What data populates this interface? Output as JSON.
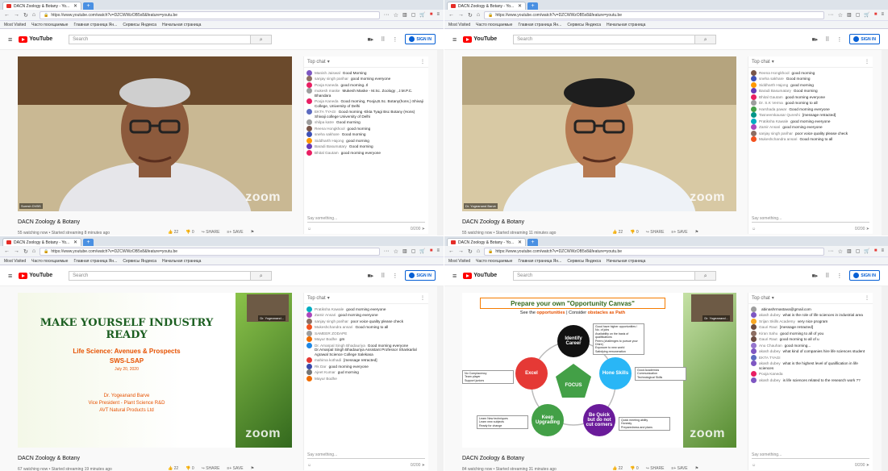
{
  "browser": {
    "tab_title": "DACN Zoology & Botany - Yo...",
    "tab_close": "✕",
    "new_tab": "+",
    "url": "https://www.youtube.com/watch?v=DZCWWzOB5x8&feature=youtu.be",
    "url_dots": "···",
    "bookmarks": [
      "Most Visited",
      "Часто посещаемые",
      "Главная страница Ян...",
      "Сервисы Яндекса",
      "Начальная страница"
    ]
  },
  "youtube": {
    "logo_text": "YouTube",
    "search_placeholder": "Search",
    "sign_in": "SIGN IN"
  },
  "video": {
    "title": "DACN Zoology & Botany",
    "zoom_watermark": "zoom",
    "actions": [
      "22",
      "0",
      "SHARE",
      "SAVE"
    ]
  },
  "chat": {
    "header": "Top chat",
    "input_placeholder": "Say something...",
    "counter": "0/200"
  },
  "panels": [
    {
      "meta": "55 watching now • Started streaming 8 minutes ago",
      "speaker": "Suresh DVBS",
      "messages": [
        {
          "author": "Manish Jaiswal",
          "text": "Good Morning",
          "color": "#7e57c2"
        },
        {
          "author": "sanjay singh parihar",
          "text": "good morning everyone",
          "color": "#8d6e63"
        },
        {
          "author": "Pooja Kaneda",
          "text": "good morning..Il",
          "color": "#e91e63"
        },
        {
          "author": "mukesh maske",
          "text": "Mukesh Maske - M.Sc. Zoology , J.M.P.C. Bhandara",
          "color": "#9e9e9e"
        },
        {
          "author": "Pooja Kaneda",
          "text": "Good morning, Pooja,B.Sc. Botany(hons.) Shivaji College, University of Delhi",
          "color": "#e91e63"
        },
        {
          "author": "EKTA TYAGI",
          "text": "Good morning -Ekta Tyagi Bsc Botany (Hons) Shivaji college University of Delhi",
          "color": "#5c6bc0"
        },
        {
          "author": "shilpa katre",
          "text": "Good morning",
          "color": "#9e9e9e"
        },
        {
          "author": "Reena Hongkhool",
          "text": "good morning",
          "color": "#795548"
        },
        {
          "author": "sneha sakhare",
          "text": "Good morning",
          "color": "#3f51b5"
        },
        {
          "author": "Siddharth Hajong",
          "text": "good morning",
          "color": "#ff9800"
        },
        {
          "author": "Baradi Basumatary",
          "text": "Good morning",
          "color": "#673ab7"
        },
        {
          "author": "Bhital Gautam",
          "text": "good morning everyone",
          "color": "#e91e63"
        }
      ]
    },
    {
      "meta": "55 watching now • Started streaming 11 minutes ago",
      "speaker": "Dr. Yogeanand Barve",
      "messages": [
        {
          "author": "Reena Hongkhool",
          "text": "good morning",
          "color": "#795548"
        },
        {
          "author": "sneha sakhare",
          "text": "Good morning",
          "color": "#3f51b5"
        },
        {
          "author": "Siddharth Hajong",
          "text": "good morning",
          "color": "#ff9800"
        },
        {
          "author": "Baradi Basumatary",
          "text": "Good morning",
          "color": "#673ab7"
        },
        {
          "author": "Bhital Gautam",
          "text": "good morning everyone",
          "color": "#e91e63"
        },
        {
          "author": "Dr. S.K Verma",
          "text": "good morning to all",
          "color": "#9e9e9e"
        },
        {
          "author": "Harshada pawar",
          "text": "Good morning everyone",
          "color": "#43a047"
        },
        {
          "author": "Tasneemkausar Qureshi",
          "text": "[message retracted]",
          "color": "#009688"
        },
        {
          "author": "Pratiksha Kawale",
          "text": "good morning everyone",
          "color": "#00acc1"
        },
        {
          "author": "Zamir Ansari",
          "text": "good morning everyone",
          "color": "#ab47bc"
        },
        {
          "author": "sanjay singh parihar",
          "text": "poor voice quality please check",
          "color": "#8d6e63"
        },
        {
          "author": "Mukeshchandra ansari",
          "text": "Good morning to all",
          "color": "#f4511e"
        }
      ]
    },
    {
      "meta": "67 watching now • Started streaming 19 minutes ago",
      "speaker": "Dr. Yogeanand...",
      "slide_title": "MAKE YOURSELF INDUSTRY READY",
      "slide_sub1": "Life Science: Avenues & Prospects",
      "slide_sub2": "SWS-LSAP",
      "slide_date": "July 20, 2020",
      "slide_name": "Dr. Yogeanand Barve",
      "slide_role": "Vice President - Plant Science R&D",
      "slide_org": "AVT Natural Products Ltd",
      "messages": [
        {
          "author": "Pratiksha Kawale",
          "text": "good morning everyone",
          "color": "#00acc1"
        },
        {
          "author": "Zamir Ansari",
          "text": "good morning everyone",
          "color": "#ab47bc"
        },
        {
          "author": "sanjay singh parihar",
          "text": "poor voice quality please check",
          "color": "#8d6e63"
        },
        {
          "author": "Mukeshchandra ansari",
          "text": "Good morning to all",
          "color": "#f4511e"
        },
        {
          "author": "SAMEER ZODAPE",
          "text": "",
          "color": "#9e9e9e"
        },
        {
          "author": "Mayur Bodhe",
          "text": "gm",
          "color": "#ef6c00"
        },
        {
          "author": "Dr. Amarpal Singh Bhadauriya",
          "text": "Good morning everyone Dr.Amarpal Singh Bhadauriya Assistant Professor Shankarlal Agrawal Science College Salekasa",
          "color": "#1e88e5"
        },
        {
          "author": "mahima kothadi",
          "text": "[message retracted]",
          "color": "#e53935"
        },
        {
          "author": "Rk Dar",
          "text": "good morning everyone",
          "color": "#3949ab"
        },
        {
          "author": "Ajeet Kumar",
          "text": "gud morning",
          "color": "#757575"
        },
        {
          "author": "Mayur Bodhe",
          "text": "",
          "color": "#ef6c00"
        }
      ]
    },
    {
      "meta": "84 watching now • Started streaming 31 minutes ago",
      "speaker": "Dr. Yogeanand...",
      "canvas_title": "Prepare your own \"Opportunity Canvas\"",
      "canvas_sub_a": "See the",
      "canvas_sub_b": "opportunities",
      "canvas_sub_c": "| Consider",
      "canvas_sub_d": "obstacles as Path",
      "canvas_nodes": {
        "identify": "Identify Career",
        "hone": "Hone Skills",
        "bequick": "Be Quick but do not cut corners",
        "keep": "Keep Upgrading",
        "excel": "Excel",
        "focus": "FOCUS"
      },
      "canvas_notes": {
        "identify": [
          "Good have higher opportunities / No. of jobs",
          "Availability on the basis of qualifications",
          "Peers (challenges to pursue your Dhire)",
          "Exposure to new world",
          "Satisfying remuneration"
        ],
        "hone": [
          "Good Academics",
          "Communication",
          "Technological Skills"
        ],
        "bequick": [
          "Quick meeting ability",
          "Honesty",
          "Preparedness and plans"
        ],
        "keep": [
          "Learn New techniques",
          "Learn new subjects",
          "Ready for change"
        ],
        "excel": [
          "No Complacency",
          "Team player",
          "Support juniors"
        ]
      },
      "messages": [
        {
          "author": "",
          "text": "abinashrmastava@gmail.com",
          "color": "#9e9e9e"
        },
        {
          "author": "akash dubey",
          "text": "what is the role of life sciences in industrial area",
          "color": "#7e57c2"
        },
        {
          "author": "Srijan Skills Academy",
          "text": "very nice program",
          "color": "#f9a825"
        },
        {
          "author": "Gauri Raut",
          "text": "[message retracted]",
          "color": "#6d4c41"
        },
        {
          "author": "Kiran Sahu",
          "text": "good morning to all of you",
          "color": "#8d6e63"
        },
        {
          "author": "Gauri Raut",
          "text": "good morning to all of u",
          "color": "#6d4c41"
        },
        {
          "author": "Anu Chauhan",
          "text": "good morning...",
          "color": "#9575cd"
        },
        {
          "author": "akash dubey",
          "text": "what kind of companies hire life sciences student",
          "color": "#7e57c2"
        },
        {
          "author": "EKTA TYAGI",
          "text": "",
          "color": "#5c6bc0"
        },
        {
          "author": "akash dubey",
          "text": "what is the highest level of qualification in life sciences",
          "color": "#7e57c2"
        },
        {
          "author": "Pooja Kaneda",
          "text": "",
          "color": "#e91e63"
        },
        {
          "author": "akash dubey",
          "text": "is life sciences related to the research work ??",
          "color": "#7e57c2"
        }
      ]
    }
  ]
}
